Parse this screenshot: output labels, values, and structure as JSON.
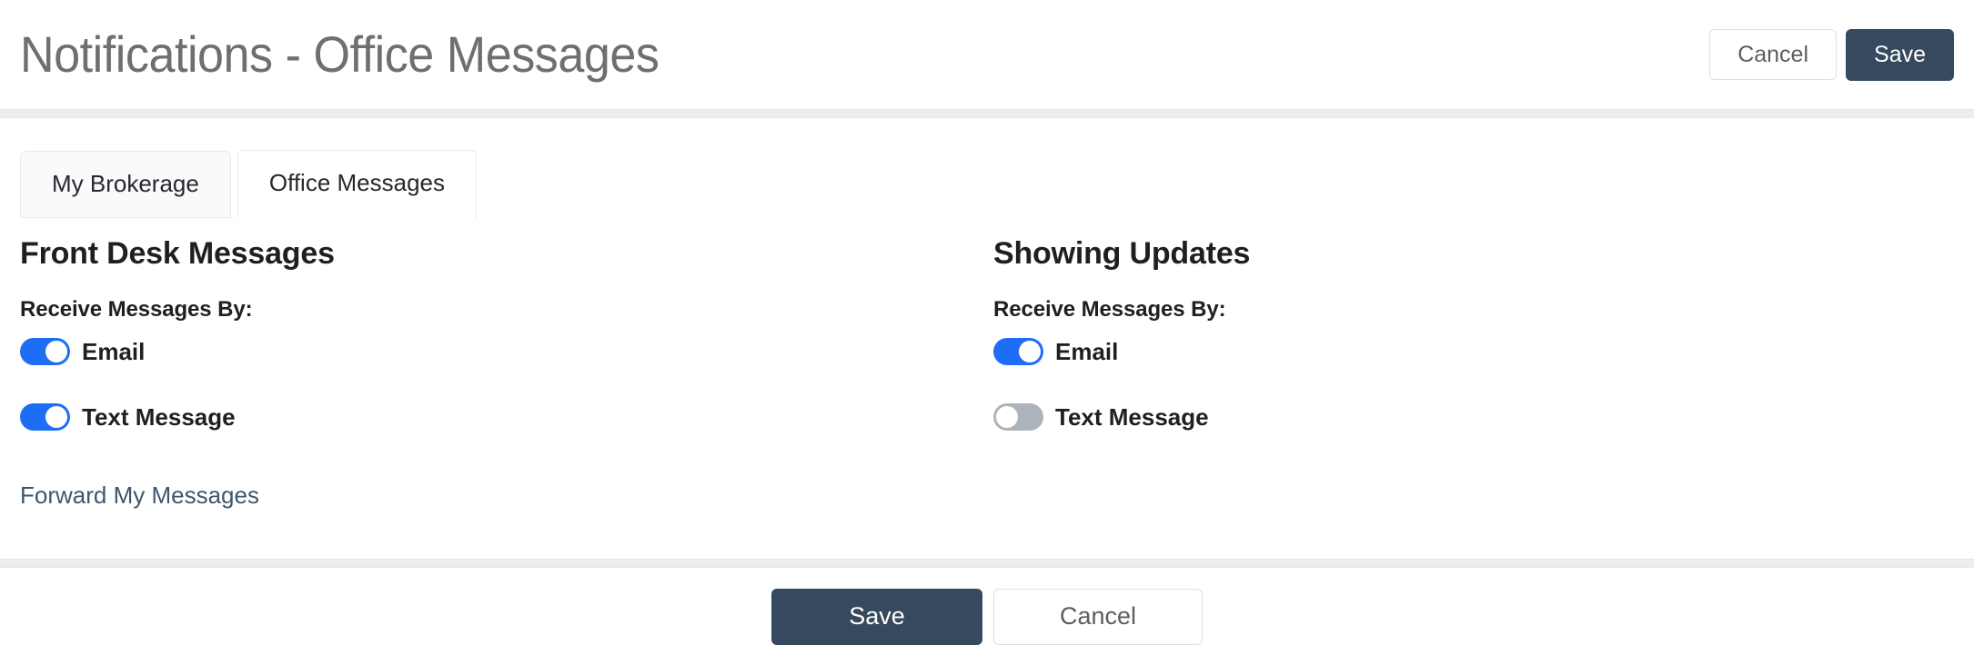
{
  "header": {
    "title": "Notifications - Office Messages",
    "cancel_label": "Cancel",
    "save_label": "Save"
  },
  "tabs": [
    {
      "label": "My Brokerage",
      "active": false
    },
    {
      "label": "Office Messages",
      "active": true
    }
  ],
  "sections": [
    {
      "title": "Front Desk Messages",
      "sub_label": "Receive Messages By:",
      "toggles": [
        {
          "label": "Email",
          "state": "on"
        },
        {
          "label": "Text Message",
          "state": "on"
        }
      ],
      "link": "Forward My Messages"
    },
    {
      "title": "Showing Updates",
      "sub_label": "Receive Messages By:",
      "toggles": [
        {
          "label": "Email",
          "state": "on"
        },
        {
          "label": "Text Message",
          "state": "off"
        }
      ]
    }
  ],
  "footer": {
    "save_label": "Save",
    "cancel_label": "Cancel"
  },
  "colors": {
    "primary_dark": "#36495e",
    "toggle_on": "#1d6ef5",
    "toggle_off": "#adb3ba",
    "link": "#3f566c",
    "title_gray": "#6d6f72",
    "band": "#eceef2"
  }
}
